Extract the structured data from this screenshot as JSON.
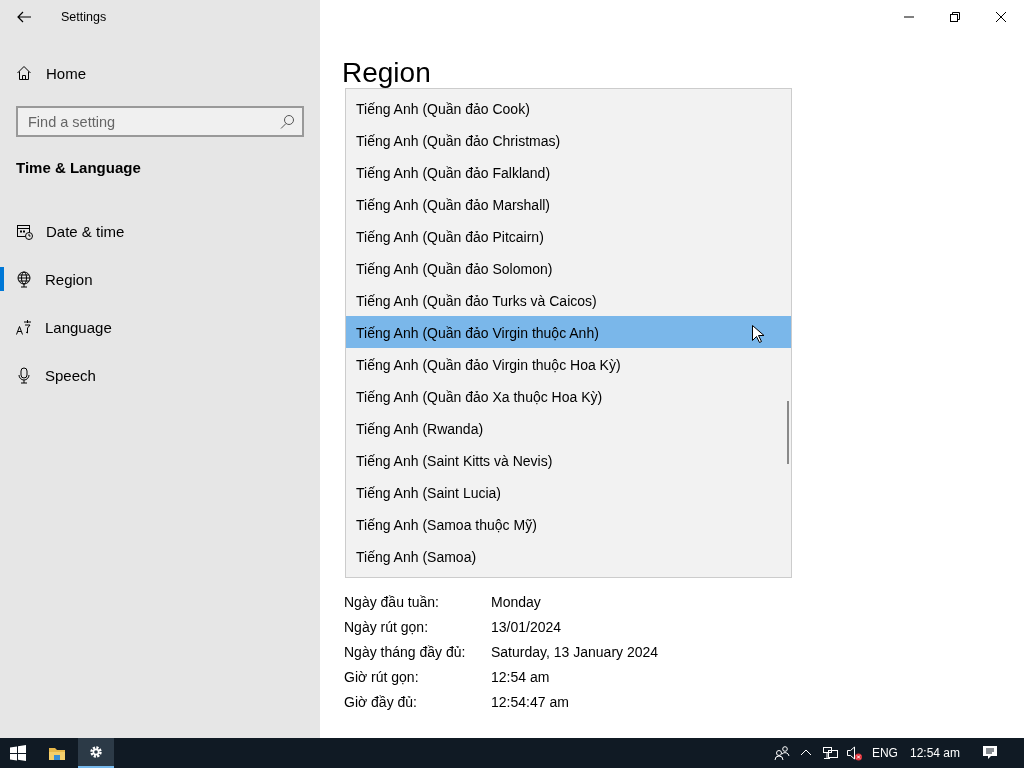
{
  "window": {
    "title": "Settings"
  },
  "sidebar": {
    "home": "Home",
    "search": {
      "placeholder": "Find a setting"
    },
    "section": "Time & Language",
    "items": [
      {
        "label": "Date & time",
        "kind": "calendar",
        "selected": false
      },
      {
        "label": "Region",
        "kind": "globe",
        "selected": true
      },
      {
        "label": "Language",
        "kind": "language",
        "selected": false
      },
      {
        "label": "Speech",
        "kind": "microphone",
        "selected": false
      }
    ]
  },
  "page": {
    "title": "Region",
    "dropdown": {
      "options": [
        {
          "label": "Tiếng Anh (Quần đảo Cook)",
          "selected": false
        },
        {
          "label": "Tiếng Anh (Quần đảo Christmas)",
          "selected": false
        },
        {
          "label": "Tiếng Anh (Quần đảo Falkland)",
          "selected": false
        },
        {
          "label": "Tiếng Anh (Quần đảo Marshall)",
          "selected": false
        },
        {
          "label": "Tiếng Anh (Quần đảo Pitcairn)",
          "selected": false
        },
        {
          "label": "Tiếng Anh (Quần đảo Solomon)",
          "selected": false
        },
        {
          "label": "Tiếng Anh (Quần đảo Turks và Caicos)",
          "selected": false
        },
        {
          "label": "Tiếng Anh (Quần đảo Virgin thuộc Anh)",
          "selected": true
        },
        {
          "label": "Tiếng Anh (Quần đảo Virgin thuộc Hoa Kỳ)",
          "selected": false
        },
        {
          "label": "Tiếng Anh (Quần đảo Xa thuộc Hoa Kỳ)",
          "selected": false
        },
        {
          "label": "Tiếng Anh (Rwanda)",
          "selected": false
        },
        {
          "label": "Tiếng Anh (Saint Kitts và Nevis)",
          "selected": false
        },
        {
          "label": "Tiếng Anh (Saint Lucia)",
          "selected": false
        },
        {
          "label": "Tiếng Anh (Samoa thuộc Mỹ)",
          "selected": false
        },
        {
          "label": "Tiếng Anh (Samoa)",
          "selected": false
        }
      ]
    },
    "format_rows": [
      {
        "label": "Ngày đầu tuần:",
        "value": "Monday"
      },
      {
        "label": "Ngày rút gọn:",
        "value": "13/01/2024"
      },
      {
        "label": "Ngày tháng đầy đủ:",
        "value": "Saturday, 13 January 2024"
      },
      {
        "label": "Giờ rút gọn:",
        "value": "12:54 am"
      },
      {
        "label": "Giờ đầy đủ:",
        "value": "12:54:47 am"
      }
    ]
  },
  "taskbar": {
    "apps": [
      {
        "kind": "folder",
        "active": false
      },
      {
        "kind": "settings",
        "active": true
      }
    ],
    "language": "ENG",
    "time": "12:54 am"
  }
}
